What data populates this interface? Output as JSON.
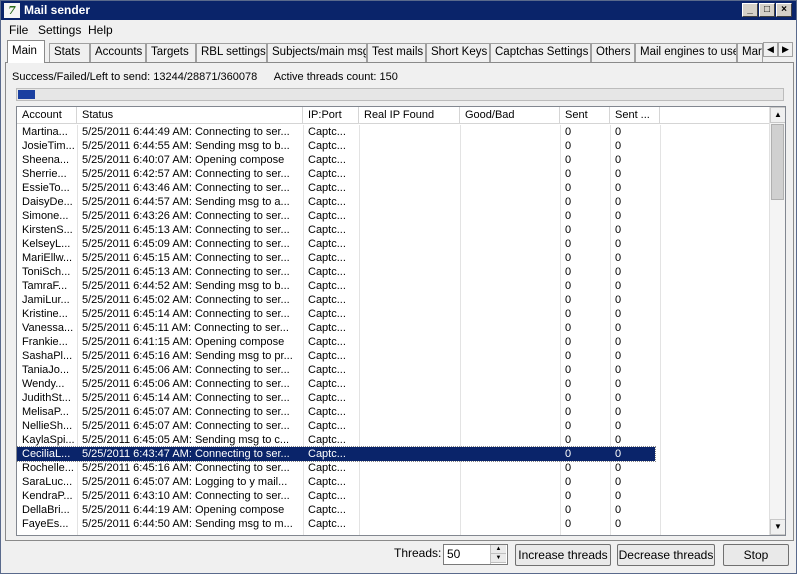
{
  "window": {
    "title": "Mail sender",
    "controls": [
      "_",
      "□",
      "×"
    ]
  },
  "menu": {
    "file": "File",
    "settings": "Settings",
    "help": "Help"
  },
  "tabs": [
    {
      "label": "Main"
    },
    {
      "label": "Stats"
    },
    {
      "label": "Accounts"
    },
    {
      "label": "Targets"
    },
    {
      "label": "RBL settings"
    },
    {
      "label": "Subjects/main msg"
    },
    {
      "label": "Test mails"
    },
    {
      "label": "Short Keys"
    },
    {
      "label": "Captchas Settings"
    },
    {
      "label": "Others"
    },
    {
      "label": "Mail engines to use"
    },
    {
      "label": "Mar"
    }
  ],
  "status": {
    "summary": "Success/Failed/Left to send: 13244/28871/360078",
    "threads": "Active threads count: 150",
    "progress": 0.022
  },
  "table": {
    "columns": [
      "Account",
      "Status",
      "IP:Port",
      "Real IP Found",
      "Good/Bad",
      "Sent",
      "Sent ..."
    ],
    "selected_index": 23,
    "rows": [
      [
        "Martina...",
        "5/25/2011 6:44:49 AM: Connecting to ser...",
        "Captc...",
        "",
        "",
        "0",
        "0"
      ],
      [
        "JosieTim...",
        "5/25/2011 6:44:55 AM: Sending msg to b...",
        "Captc...",
        "",
        "",
        "0",
        "0"
      ],
      [
        "Sheena...",
        "5/25/2011 6:40:07 AM: Opening compose",
        "Captc...",
        "",
        "",
        "0",
        "0"
      ],
      [
        "Sherrie...",
        "5/25/2011 6:42:57 AM: Connecting to ser...",
        "Captc...",
        "",
        "",
        "0",
        "0"
      ],
      [
        "EssieTo...",
        "5/25/2011 6:43:46 AM: Connecting to ser...",
        "Captc...",
        "",
        "",
        "0",
        "0"
      ],
      [
        "DaisyDe...",
        "5/25/2011 6:44:57 AM: Sending msg to a...",
        "Captc...",
        "",
        "",
        "0",
        "0"
      ],
      [
        "Simone...",
        "5/25/2011 6:43:26 AM: Connecting to ser...",
        "Captc...",
        "",
        "",
        "0",
        "0"
      ],
      [
        "KirstenS...",
        "5/25/2011 6:45:13 AM: Connecting to ser...",
        "Captc...",
        "",
        "",
        "0",
        "0"
      ],
      [
        "KelseyL...",
        "5/25/2011 6:45:09 AM: Connecting to ser...",
        "Captc...",
        "",
        "",
        "0",
        "0"
      ],
      [
        "MariEllw...",
        "5/25/2011 6:45:15 AM: Connecting to ser...",
        "Captc...",
        "",
        "",
        "0",
        "0"
      ],
      [
        "ToniSch...",
        "5/25/2011 6:45:13 AM: Connecting to ser...",
        "Captc...",
        "",
        "",
        "0",
        "0"
      ],
      [
        "TamraF...",
        "5/25/2011 6:44:52 AM: Sending msg to b...",
        "Captc...",
        "",
        "",
        "0",
        "0"
      ],
      [
        "JamiLur...",
        "5/25/2011 6:45:02 AM: Connecting to ser...",
        "Captc...",
        "",
        "",
        "0",
        "0"
      ],
      [
        "Kristine...",
        "5/25/2011 6:45:14 AM: Connecting to ser...",
        "Captc...",
        "",
        "",
        "0",
        "0"
      ],
      [
        "Vanessa...",
        "5/25/2011 6:45:11 AM: Connecting to ser...",
        "Captc...",
        "",
        "",
        "0",
        "0"
      ],
      [
        "Frankie...",
        "5/25/2011 6:41:15 AM: Opening compose",
        "Captc...",
        "",
        "",
        "0",
        "0"
      ],
      [
        "SashaPl...",
        "5/25/2011 6:45:16 AM: Sending msg to pr...",
        "Captc...",
        "",
        "",
        "0",
        "0"
      ],
      [
        "TaniaJo...",
        "5/25/2011 6:45:06 AM: Connecting to ser...",
        "Captc...",
        "",
        "",
        "0",
        "0"
      ],
      [
        "Wendy...",
        "5/25/2011 6:45:06 AM: Connecting to ser...",
        "Captc...",
        "",
        "",
        "0",
        "0"
      ],
      [
        "JudithSt...",
        "5/25/2011 6:45:14 AM: Connecting to ser...",
        "Captc...",
        "",
        "",
        "0",
        "0"
      ],
      [
        "MelisaP...",
        "5/25/2011 6:45:07 AM: Connecting to ser...",
        "Captc...",
        "",
        "",
        "0",
        "0"
      ],
      [
        "NellieSh...",
        "5/25/2011 6:45:07 AM: Connecting to ser...",
        "Captc...",
        "",
        "",
        "0",
        "0"
      ],
      [
        "KaylaSpi...",
        "5/25/2011 6:45:05 AM: Sending msg to c...",
        "Captc...",
        "",
        "",
        "0",
        "0"
      ],
      [
        "CeciliaL...",
        "5/25/2011 6:43:47 AM: Connecting to ser...",
        "Captc...",
        "",
        "",
        "0",
        "0"
      ],
      [
        "Rochelle...",
        "5/25/2011 6:45:16 AM: Connecting to ser...",
        "Captc...",
        "",
        "",
        "0",
        "0"
      ],
      [
        "SaraLuc...",
        "5/25/2011 6:45:07 AM: Logging to y mail...",
        "Captc...",
        "",
        "",
        "0",
        "0"
      ],
      [
        "KendraP...",
        "5/25/2011 6:43:10 AM: Connecting to ser...",
        "Captc...",
        "",
        "",
        "0",
        "0"
      ],
      [
        "DellaBri...",
        "5/25/2011 6:44:19 AM: Opening compose",
        "Captc...",
        "",
        "",
        "0",
        "0"
      ],
      [
        "FayeEs...",
        "5/25/2011 6:44:50 AM: Sending msg to m...",
        "Captc...",
        "",
        "",
        "0",
        "0"
      ]
    ]
  },
  "controls": {
    "threads_label": "Threads:",
    "threads_value": "50",
    "increase": "Increase threads",
    "decrease": "Decrease threads",
    "stop": "Stop"
  },
  "colors": {
    "title_bar": "#0a246a",
    "selection": "#0a246a",
    "progress": "#1a3fa0"
  }
}
